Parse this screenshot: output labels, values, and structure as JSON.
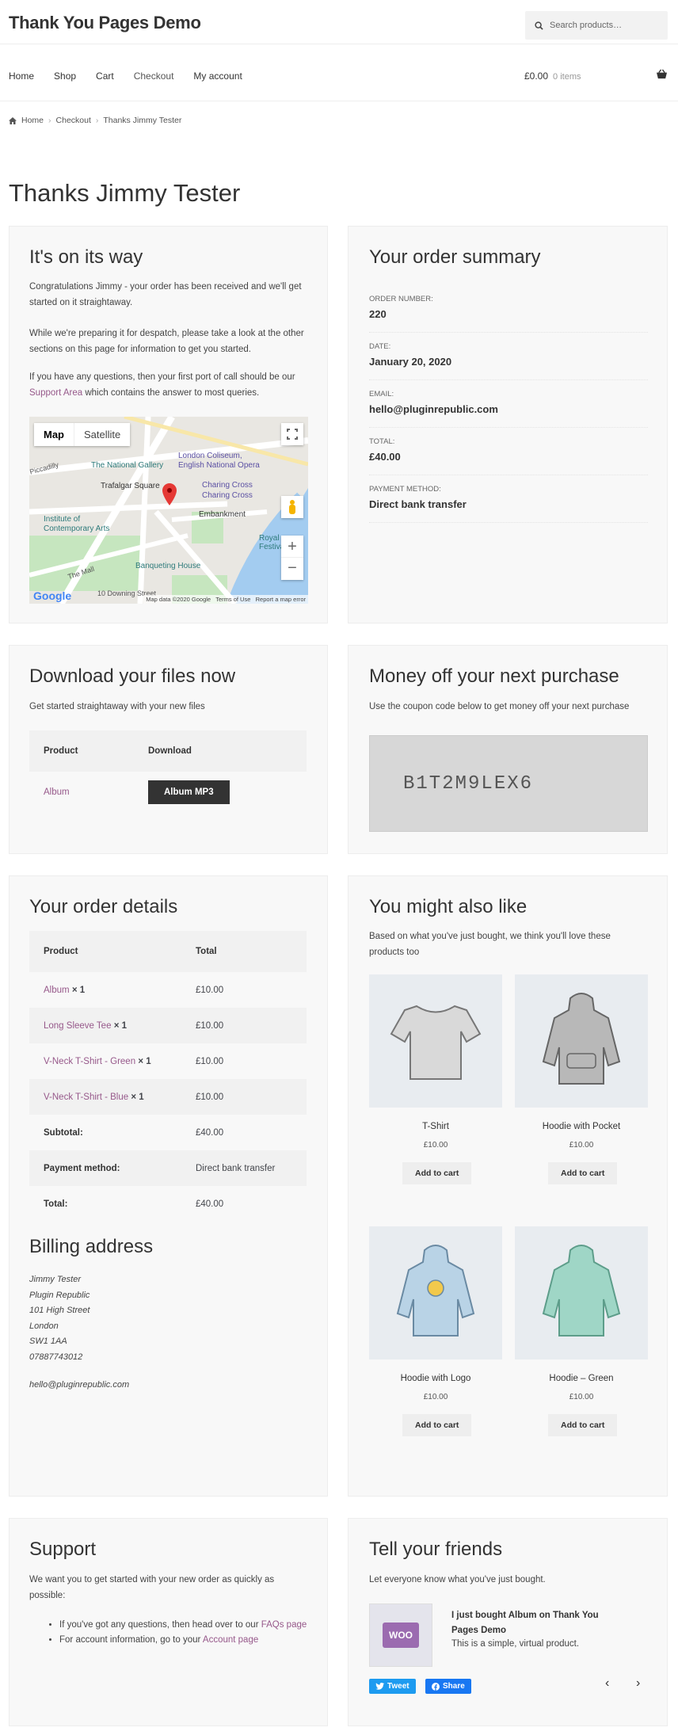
{
  "site": {
    "title": "Thank You Pages Demo",
    "search_placeholder": "Search products…"
  },
  "nav": {
    "items": [
      "Home",
      "Shop",
      "Cart",
      "Checkout",
      "My account"
    ],
    "cart_amount": "£0.00",
    "cart_items": "0 items"
  },
  "breadcrumb": {
    "home": "Home",
    "checkout": "Checkout",
    "current": "Thanks Jimmy Tester"
  },
  "page_title": "Thanks Jimmy Tester",
  "on_its_way": {
    "title": "It's on its way",
    "p1": "Congratulations Jimmy - your order has been received and we'll get started on it straightaway.",
    "p2": "While we're preparing it for despatch, please take a look at the other sections on this page for information to get you started.",
    "p3_prefix": "If you have any questions, then your first port of call should be our ",
    "p3_link": "Support Area",
    "p3_suffix": " which contains the answer to most queries.",
    "map": {
      "tab_map": "Map",
      "tab_satellite": "Satellite",
      "labels": [
        "London Coliseum, English National Opera",
        "The National Gallery",
        "Trafalgar Square",
        "Charing Cross",
        "Charing Cross",
        "Embankment",
        "Institute of Contemporary Arts",
        "Banqueting House",
        "10 Downing Street",
        "The Mall",
        "Piccadilly",
        "Royal Festival Hall"
      ],
      "footer": "Map data ©2020 Google   Terms of Use   Report a map error",
      "google": "Google"
    }
  },
  "order_summary": {
    "title": "Your order summary",
    "rows": [
      {
        "label": "ORDER NUMBER:",
        "value": "220"
      },
      {
        "label": "DATE:",
        "value": "January 20, 2020"
      },
      {
        "label": "EMAIL:",
        "value": "hello@pluginrepublic.com"
      },
      {
        "label": "TOTAL:",
        "value": "£40.00"
      },
      {
        "label": "PAYMENT METHOD:",
        "value": "Direct bank transfer"
      }
    ]
  },
  "downloads": {
    "title": "Download your files now",
    "subtitle": "Get started straightaway with your new files",
    "col_product": "Product",
    "col_download": "Download",
    "product": "Album",
    "button": "Album MP3"
  },
  "coupon": {
    "title": "Money off your next purchase",
    "subtitle": "Use the coupon code below to get money off your next purchase",
    "code": "B1T2M9LEX6"
  },
  "order_details": {
    "title": "Your order details",
    "col_product": "Product",
    "col_total": "Total",
    "items": [
      {
        "name": "Album",
        "qty": "× 1",
        "total": "£10.00"
      },
      {
        "name": "Long Sleeve Tee",
        "qty": "× 1",
        "total": "£10.00"
      },
      {
        "name": "V-Neck T-Shirt - Green",
        "qty": "× 1",
        "total": "£10.00"
      },
      {
        "name": "V-Neck T-Shirt - Blue",
        "qty": "× 1",
        "total": "£10.00"
      }
    ],
    "subtotal_label": "Subtotal:",
    "subtotal": "£40.00",
    "payment_label": "Payment method:",
    "payment": "Direct bank transfer",
    "total_label": "Total:",
    "total": "£40.00"
  },
  "billing": {
    "title": "Billing address",
    "lines": [
      "Jimmy Tester",
      "Plugin Republic",
      "101 High Street",
      "London",
      "SW1 1AA",
      "07887743012"
    ],
    "email": "hello@pluginrepublic.com"
  },
  "also_like": {
    "title": "You might also like",
    "subtitle": "Based on what you've just bought, we think you'll love these products too",
    "products": [
      {
        "name": "T-Shirt",
        "price": "£10.00",
        "button": "Add to cart",
        "color": "#d9d9d9"
      },
      {
        "name": "Hoodie with Pocket",
        "price": "£10.00",
        "button": "Add to cart",
        "color": "#b8b8b8"
      },
      {
        "name": "Hoodie with Logo",
        "price": "£10.00",
        "button": "Add to cart",
        "color": "#b9d3e6"
      },
      {
        "name": "Hoodie – Green",
        "price": "£10.00",
        "button": "Add to cart",
        "color": "#9fd6c6"
      }
    ]
  },
  "support": {
    "title": "Support",
    "intro": "We want you to get started with your new order as quickly as possible:",
    "b1_prefix": "If you've got any questions, then head over to our ",
    "b1_link": "FAQs page",
    "b2_prefix": "For account information, go to your ",
    "b2_link": "Account page"
  },
  "tell_friends": {
    "title": "Tell your friends",
    "subtitle": "Let everyone know what you've just bought.",
    "card_title": "I just bought Album on Thank You Pages Demo",
    "card_desc": "This is a simple, virtual product.",
    "tweet": "Tweet",
    "share": "Share",
    "logo_text": "WOO"
  },
  "colors": {
    "accent": "#96588a",
    "panel_bg": "#f8f8f8",
    "dark_button": "#333333"
  }
}
